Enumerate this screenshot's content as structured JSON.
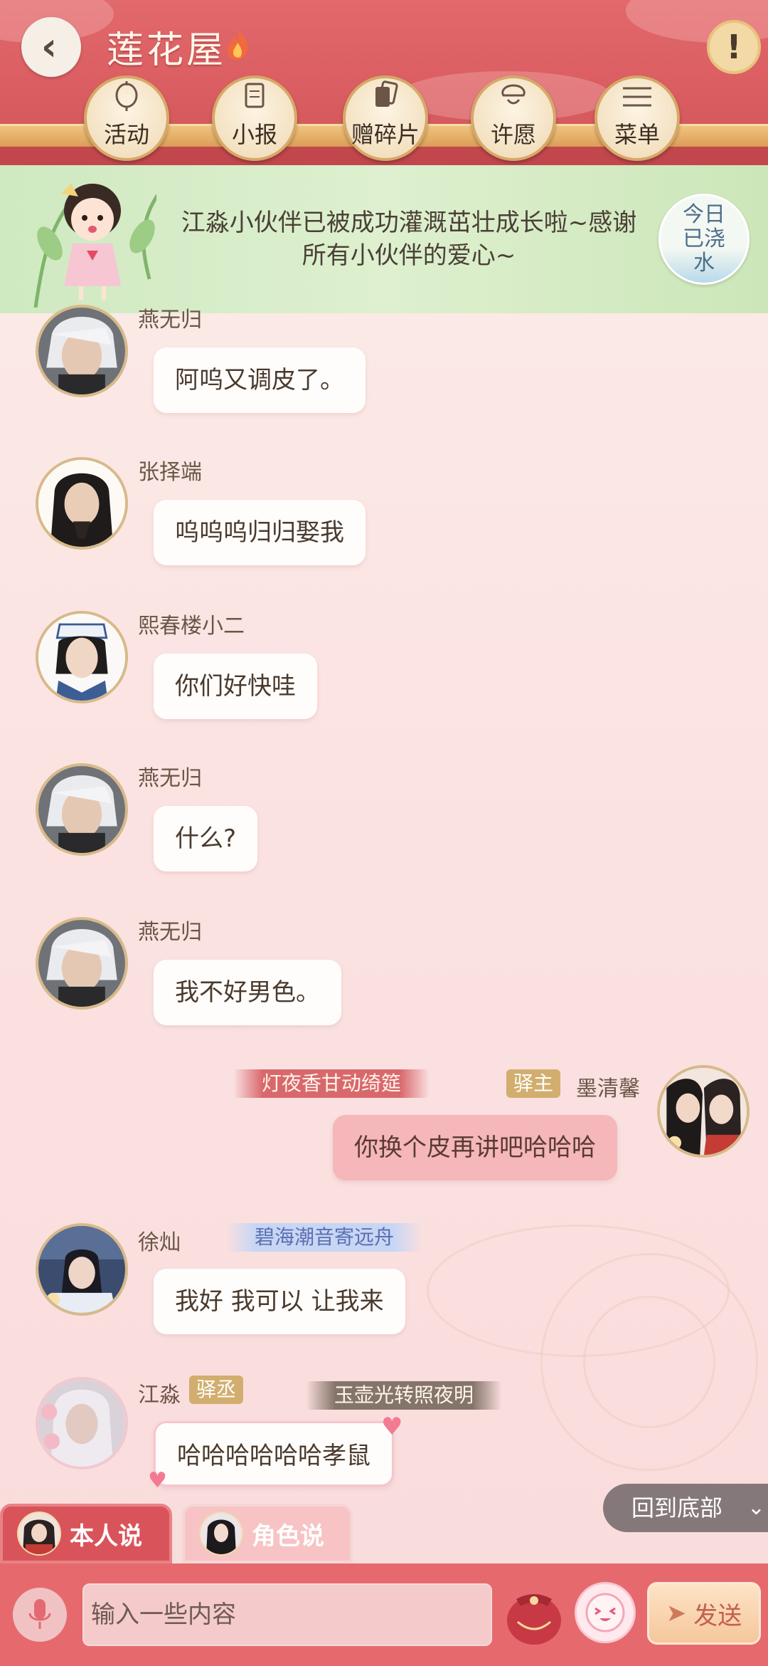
{
  "header": {
    "title": "莲花屋",
    "flame_icon": "flame-icon",
    "info_symbol": "!",
    "nav": [
      {
        "label": "活动",
        "icon": "lantern-icon"
      },
      {
        "label": "小报",
        "icon": "scroll-icon"
      },
      {
        "label": "赠碎片",
        "icon": "cards-icon"
      },
      {
        "label": "许愿",
        "icon": "wish-tree-icon"
      },
      {
        "label": "菜单",
        "icon": "menu-icon"
      }
    ]
  },
  "notice": {
    "text": "江淼小伙伴已被成功灌溉茁壮成长啦~感谢所有小伙伴的爱心~",
    "water_button": "今日已浇水"
  },
  "messages": [
    {
      "name": "燕无归",
      "text": "阿呜又调皮了。"
    },
    {
      "name": "张择端",
      "text": "呜呜呜归归娶我"
    },
    {
      "name": "熙春楼小二",
      "text": "你们好快哇"
    },
    {
      "name": "燕无归",
      "text": "什么?"
    },
    {
      "name": "燕无归",
      "text": "我不好男色。"
    },
    {
      "name": "墨清馨",
      "title_banner": "灯夜香甘动绮筵",
      "rank_tag": "驿主",
      "text": "你换个皮再讲吧哈哈哈"
    },
    {
      "name": "徐灿",
      "title_banner": "碧海潮音寄远舟",
      "text": "我好 我可以 让我来"
    },
    {
      "name": "江淼",
      "rank_tag": "驿丞",
      "title_banner": "玉壶光转照夜明",
      "text": "哈哈哈哈哈哈孝鼠"
    }
  ],
  "back_to_bottom": "回到底部",
  "mode_tabs": {
    "self": "本人说",
    "role": "角色说"
  },
  "composer": {
    "placeholder": "输入一些内容",
    "send": "发送"
  },
  "colors": {
    "header_red": "#d95c60",
    "bubble_mine": "#f5b7ba",
    "notice_green": "#d6edc8",
    "gold": "#d2ae6e"
  }
}
